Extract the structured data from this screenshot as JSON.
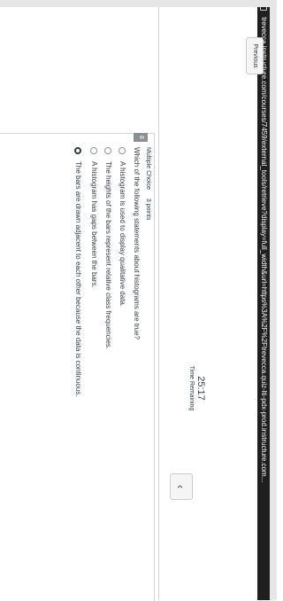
{
  "browser": {
    "url": "trevecca.instructure.com/courses/7459/external_tools/retrieve?display=full_width&url=https%3A%2F%2Ftrevecca.quiz-lti-pdx-prod.instructure.com..."
  },
  "timer": {
    "time": "25:17",
    "label": "Time Remaining"
  },
  "question": {
    "number": "8",
    "type": "Multiple Choice",
    "points": "3 points",
    "prompt": "Which of the following statements about histograms are true?",
    "options": [
      {
        "text": "A histogram is used to display qualitative data.",
        "selected": false
      },
      {
        "text": "The heights of the bars represent relative class frequencies.",
        "selected": false
      },
      {
        "text": "A histogram has gaps between the bars.",
        "selected": false
      },
      {
        "text": "The bars are drawn adjacent to each other because the data is continuous.",
        "selected": true
      }
    ]
  },
  "nav": {
    "previous_label": "Previous"
  }
}
